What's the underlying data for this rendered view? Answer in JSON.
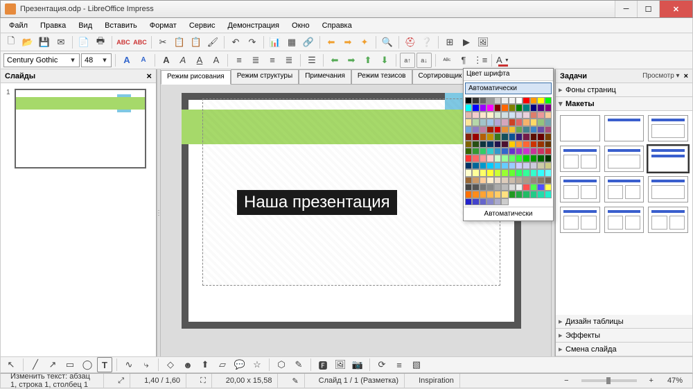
{
  "window": {
    "title": "Презентация.odp - LibreOffice Impress"
  },
  "menu": [
    "Файл",
    "Правка",
    "Вид",
    "Вставить",
    "Формат",
    "Сервис",
    "Демонстрация",
    "Окно",
    "Справка"
  ],
  "font": {
    "name": "Century Gothic",
    "size": "48"
  },
  "slides_panel": {
    "title": "Слайды",
    "close": "×",
    "thumb_num": "1"
  },
  "tabs": [
    "Режим рисования",
    "Режим структуры",
    "Примечания",
    "Режим тезисов",
    "Сортировщик слайдов"
  ],
  "slide_text": "Наша презентация",
  "tasks": {
    "title": "Задачи",
    "view": "Просмотр ▾",
    "close": "×",
    "sections": [
      "Фоны страниц",
      "Макеты",
      "Дизайн таблицы",
      "Эффекты",
      "Смена слайда"
    ]
  },
  "color_picker": {
    "title": "Цвет шрифта",
    "auto": "Автоматически",
    "footer": "Автоматически",
    "colors": [
      "#000000",
      "#333333",
      "#666666",
      "#999999",
      "#cccccc",
      "#eeeeee",
      "#f3f3f3",
      "#ffffff",
      "#ff0000",
      "#ff9900",
      "#ffff00",
      "#00ff00",
      "#00ffff",
      "#0000ff",
      "#9900ff",
      "#ff00ff",
      "#800000",
      "#ff6600",
      "#808000",
      "#008000",
      "#008080",
      "#000080",
      "#4b0082",
      "#800080",
      "#e6b8af",
      "#f4cccc",
      "#fce5cd",
      "#fff2cc",
      "#d9ead3",
      "#d0e0e3",
      "#cfe2f3",
      "#d9d2e9",
      "#ead1dc",
      "#dd7e6b",
      "#ea9999",
      "#f9cb9c",
      "#ffe599",
      "#b6d7a8",
      "#a2c4c9",
      "#9fc5e8",
      "#b4a7d6",
      "#d5a6bd",
      "#cc4125",
      "#e06666",
      "#f6b26b",
      "#ffd966",
      "#93c47d",
      "#76a5af",
      "#6fa8dc",
      "#8e7cc3",
      "#c27ba0",
      "#a61c00",
      "#cc0000",
      "#e69138",
      "#f1c232",
      "#6aa84f",
      "#45818e",
      "#3d85c6",
      "#674ea7",
      "#a64d79",
      "#85200c",
      "#990000",
      "#b45f06",
      "#bf9000",
      "#38761d",
      "#134f5c",
      "#0b5394",
      "#351c75",
      "#741b47",
      "#5b0f00",
      "#660000",
      "#783f04",
      "#7f6000",
      "#274e13",
      "#0c343d",
      "#073763",
      "#20124d",
      "#4c1130",
      "#ffcc00",
      "#ff9933",
      "#ff6633",
      "#cc3300",
      "#993300",
      "#663300",
      "#336600",
      "#339933",
      "#33cc66",
      "#33cccc",
      "#3399cc",
      "#3366cc",
      "#6633cc",
      "#9933cc",
      "#cc33cc",
      "#cc3399",
      "#cc3366",
      "#cc3333",
      "#ff3333",
      "#ff6666",
      "#ff9999",
      "#ffcccc",
      "#ccffcc",
      "#99ff99",
      "#66ff66",
      "#33ff33",
      "#00cc00",
      "#009900",
      "#006600",
      "#003300",
      "#003366",
      "#006699",
      "#0099cc",
      "#00ccff",
      "#33ccff",
      "#66ccff",
      "#99ccff",
      "#ccccff",
      "#ccccee",
      "#ccccdd",
      "#ccccaa",
      "#cccc88",
      "#ffffcc",
      "#ffff99",
      "#ffff66",
      "#ffff33",
      "#ccff33",
      "#99ff33",
      "#66ff33",
      "#33ff66",
      "#33ff99",
      "#33ffcc",
      "#33ffff",
      "#66ffff",
      "#996633",
      "#cc9966",
      "#ffcc99",
      "#ffeecc",
      "#eeddcc",
      "#ddccbb",
      "#ccbbaa",
      "#bbaa99",
      "#aa9988",
      "#998877",
      "#887766",
      "#776655",
      "#444444",
      "#555555",
      "#777777",
      "#888888",
      "#aaaaaa",
      "#bbbbbb",
      "#dddddd",
      "#f0f0f0",
      "#ff5050",
      "#50ff50",
      "#5050ff",
      "#ffff50",
      "#ff7000",
      "#ff8c1a",
      "#ffa333",
      "#ffb84d",
      "#ffcc66",
      "#ffe080",
      "#229922",
      "#22aa44",
      "#22bb66",
      "#22cc88",
      "#22ddaa",
      "#22eecc",
      "#2222cc",
      "#4444cc",
      "#6666cc",
      "#8888cc",
      "#aaaacc",
      "#cccccc"
    ]
  },
  "status": {
    "edit": "Изменить текст: абзац 1, строка 1, столбец 1",
    "pos": "1,40 / 1,60",
    "size": "20,00 x 15,58",
    "slide": "Слайд 1 / 1 (Разметка)",
    "master": "Inspiration",
    "zoom": "47%"
  }
}
